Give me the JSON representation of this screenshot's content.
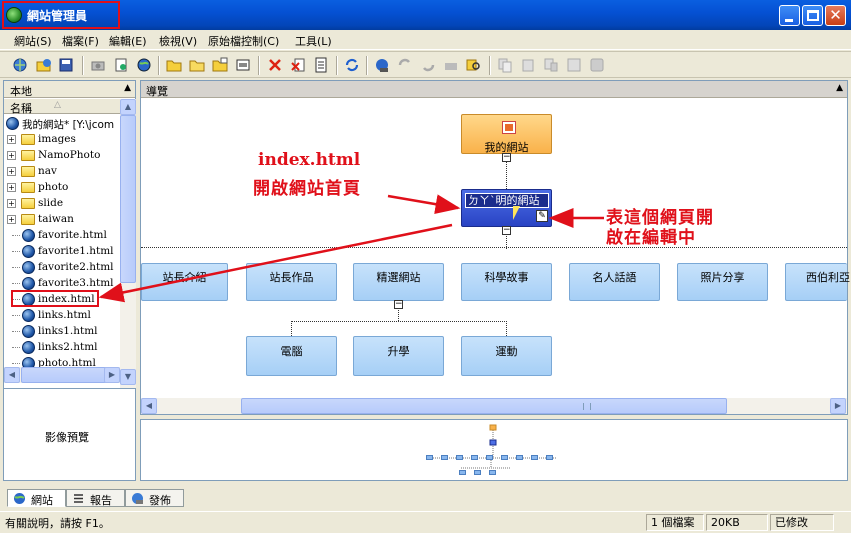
{
  "window": {
    "title": "網站管理員"
  },
  "menu": [
    "網站(S)",
    "檔案(F)",
    "編輯(E)",
    "檢視(V)",
    "原始檔控制(C)",
    "工具(L)"
  ],
  "left_panel": {
    "header": "本地",
    "column_name": "名稱",
    "items": [
      {
        "label": "我的網站* [Y:\\jcom",
        "type": "root"
      },
      {
        "label": "images",
        "type": "folder"
      },
      {
        "label": "NamoPhoto",
        "type": "folder"
      },
      {
        "label": "nav",
        "type": "folder"
      },
      {
        "label": "photo",
        "type": "folder"
      },
      {
        "label": "slide",
        "type": "folder"
      },
      {
        "label": "taiwan",
        "type": "folder"
      },
      {
        "label": "favorite.html",
        "type": "file"
      },
      {
        "label": "favorite1.html",
        "type": "file"
      },
      {
        "label": "favorite2.html",
        "type": "file"
      },
      {
        "label": "favorite3.html",
        "type": "file"
      },
      {
        "label": "index.html",
        "type": "file"
      },
      {
        "label": "links.html",
        "type": "file"
      },
      {
        "label": "links1.html",
        "type": "file"
      },
      {
        "label": "links2.html",
        "type": "file"
      },
      {
        "label": "photo.html",
        "type": "file"
      }
    ]
  },
  "preview_panel": {
    "label": "影像預覽"
  },
  "navigation": {
    "header": "導覽",
    "home_node": "我的網站",
    "selected_node_edit": "ㄉㄚˋ明的網站",
    "level2": [
      "站長介紹",
      "站長作品",
      "精選網站",
      "科學故事",
      "名人話語",
      "照片分享",
      "西伯利亞"
    ],
    "level3": [
      "電腦",
      "升學",
      "運動"
    ]
  },
  "annotations": {
    "index_title": "index.html",
    "index_desc": "開啟網站首頁",
    "edit_line1": "表這個網頁開",
    "edit_line2": "啟在編輯中"
  },
  "tabs": [
    "網站",
    "報告",
    "發佈"
  ],
  "status": {
    "help": "有關說明，請按 F1。",
    "file_count": "1 個檔案",
    "size": "20KB",
    "state": "已修改"
  },
  "colors": {
    "accent_red": "#e0101a",
    "title_blue": "#0551d4",
    "node_blue": "#a6cff6",
    "home_orange": "#f9b24a"
  }
}
